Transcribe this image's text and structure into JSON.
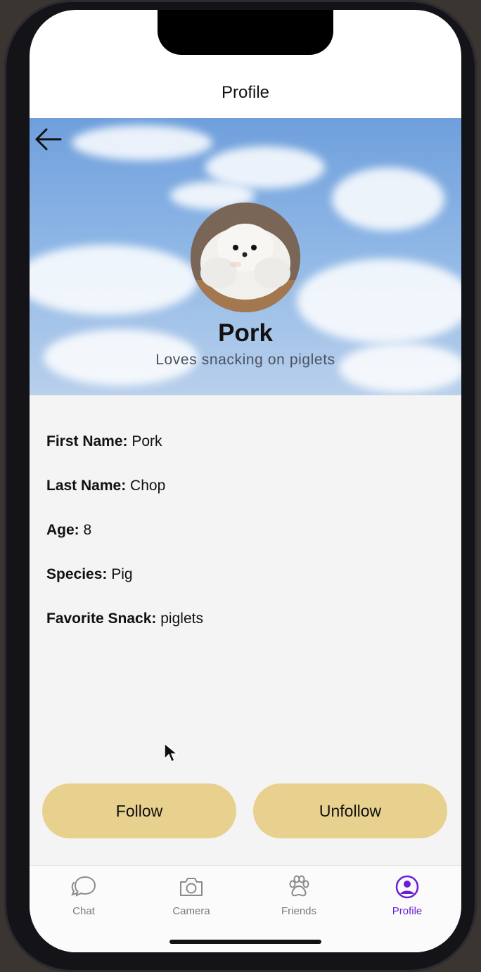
{
  "nav": {
    "title": "Profile"
  },
  "header": {
    "back_icon": "arrow-left-icon",
    "name": "Pork",
    "bio": "Loves snacking on piglets"
  },
  "details": [
    {
      "label": "First Name:",
      "value": "Pork"
    },
    {
      "label": "Last Name:",
      "value": "Chop"
    },
    {
      "label": "Age:",
      "value": "8"
    },
    {
      "label": "Species:",
      "value": "Pig"
    },
    {
      "label": "Favorite Snack:",
      "value": "piglets"
    }
  ],
  "actions": {
    "follow_label": "Follow",
    "unfollow_label": "Unfollow"
  },
  "tabs": [
    {
      "label": "Chat",
      "icon": "chat-icon"
    },
    {
      "label": "Camera",
      "icon": "camera-icon"
    },
    {
      "label": "Friends",
      "icon": "paw-icon"
    },
    {
      "label": "Profile",
      "icon": "profile-icon",
      "active": true
    }
  ],
  "colors": {
    "accent": "#6b1fd1",
    "button": "#e8d08e"
  }
}
